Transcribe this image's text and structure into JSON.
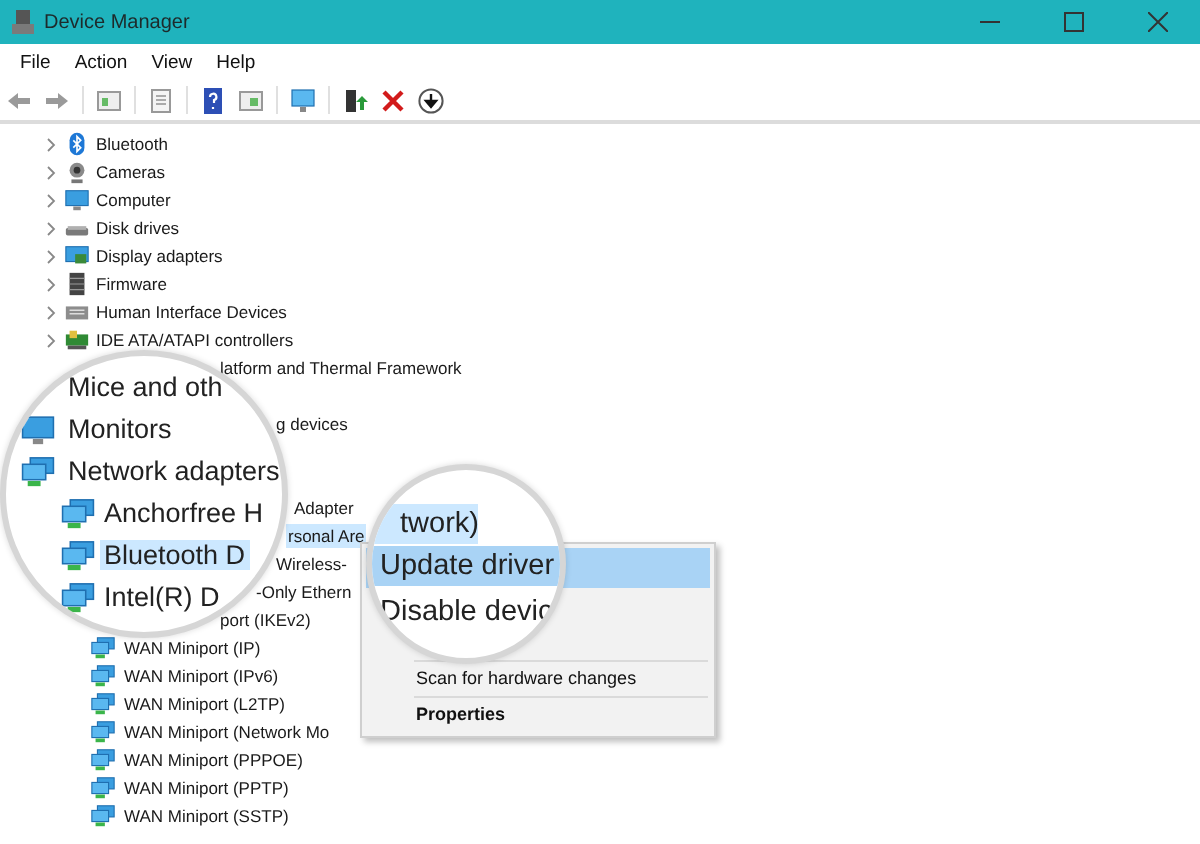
{
  "window": {
    "title": "Device Manager"
  },
  "menu_bar": [
    "File",
    "Action",
    "View",
    "Help"
  ],
  "tree": [
    {
      "label": "Bluetooth",
      "kind": "category",
      "selected": false
    },
    {
      "label": "Cameras",
      "kind": "category",
      "selected": false
    },
    {
      "label": "Computer",
      "kind": "category",
      "selected": false
    },
    {
      "label": "Disk drives",
      "kind": "category",
      "selected": false
    },
    {
      "label": "Display adapters",
      "kind": "category",
      "selected": false
    },
    {
      "label": "Firmware",
      "kind": "category",
      "selected": false
    },
    {
      "label": "Human Interface Devices",
      "kind": "category",
      "selected": false
    },
    {
      "label": "IDE ATA/ATAPI controllers",
      "kind": "category",
      "selected": false
    },
    {
      "label": "latform and Thermal Framework",
      "kind": "category",
      "selected": false
    },
    {
      "kind": "hidden"
    },
    {
      "label": "g devices",
      "kind": "category",
      "selected": false
    },
    {
      "kind": "hidden"
    },
    {
      "kind": "hidden"
    },
    {
      "label": "Adapter",
      "kind": "device",
      "selected": false
    },
    {
      "label": "rsonal Are",
      "kind": "device",
      "selected": true
    },
    {
      "label": "Wireless-",
      "kind": "device",
      "selected": false
    },
    {
      "label": "-Only Ethern",
      "kind": "device",
      "selected": false
    },
    {
      "label": "port (IKEv2)",
      "kind": "device",
      "selected": false
    },
    {
      "label": "WAN Miniport (IP)",
      "kind": "device",
      "selected": false
    },
    {
      "label": "WAN Miniport (IPv6)",
      "kind": "device",
      "selected": false
    },
    {
      "label": "WAN Miniport (L2TP)",
      "kind": "device",
      "selected": false
    },
    {
      "label": "WAN Miniport (Network Mo",
      "kind": "device",
      "selected": false
    },
    {
      "label": "WAN Miniport (PPPOE)",
      "kind": "device",
      "selected": false
    },
    {
      "label": "WAN Miniport (PPTP)",
      "kind": "device",
      "selected": false
    },
    {
      "label": "WAN Miniport (SSTP)",
      "kind": "device",
      "selected": false
    }
  ],
  "context_menu": [
    {
      "kind": "covered",
      "selected": true
    },
    {
      "kind": "covered",
      "selected": false
    },
    {
      "kind": "covered",
      "selected": false
    },
    {
      "kind": "separator"
    },
    {
      "kind": "item",
      "label": "Scan for hardware changes",
      "bold": false
    },
    {
      "kind": "separator"
    },
    {
      "kind": "item",
      "label": "Properties",
      "bold": true
    }
  ],
  "magnifier_tree": [
    {
      "label": "Mice and oth",
      "kind": "category",
      "selected": false
    },
    {
      "label": "Monitors",
      "kind": "category",
      "selected": false
    },
    {
      "label": "Network adapters",
      "kind": "category",
      "selected": false
    },
    {
      "label": "Anchorfree H",
      "kind": "device",
      "selected": false
    },
    {
      "label": "Bluetooth D",
      "kind": "device",
      "selected": true
    },
    {
      "label": "Intel(R) D",
      "kind": "device",
      "selected": false
    }
  ],
  "magnifier_menu": [
    {
      "label": "twork)",
      "kind": "tree-row",
      "selected": true
    },
    {
      "label": "Update driver",
      "kind": "menu-item",
      "selected": true
    },
    {
      "label": "Disable devic",
      "kind": "menu-item",
      "selected": false
    }
  ]
}
